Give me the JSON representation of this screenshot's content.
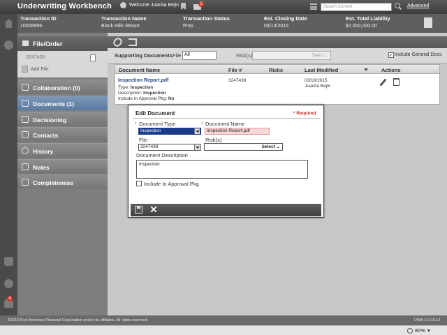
{
  "app": {
    "title": "Underwriting Workbench",
    "welcome": "Welcome Juanita Bejin",
    "mail_count": "2",
    "search_placeholder": "Search Content",
    "advanced_label": "Advanced"
  },
  "transaction": {
    "columns": [
      {
        "label": "Transaction ID",
        "value": "10008999"
      },
      {
        "label": "Transaction Name",
        "value": "Black Hills Resort"
      },
      {
        "label": "Transaction Status",
        "value": "Prep"
      },
      {
        "label": "Est. Closing Date",
        "value": "03/13/2015"
      },
      {
        "label": "Est. Total Liability",
        "value": "$7,000,000.00"
      }
    ]
  },
  "rail": {
    "notification_count": "4"
  },
  "sidebar": {
    "header": "File/Order",
    "file_number": "3247438",
    "add_file": "Add File",
    "items": [
      {
        "label": "Collaboration (0)"
      },
      {
        "label": "Documents (1)"
      },
      {
        "label": "Decisioning"
      },
      {
        "label": "Contacts"
      },
      {
        "label": "History"
      },
      {
        "label": "Notes"
      },
      {
        "label": "Completeness"
      }
    ]
  },
  "documents": {
    "title": "Supporting Documents",
    "file_label": "File",
    "file_value": "All",
    "risks_label": "Risk(s)",
    "risks_placeholder": "Select ⌄",
    "include_general_label": "Include General Docs",
    "include_general_checked": "✓",
    "columns": [
      "Document Name",
      "File #",
      "Risks",
      "Last Modified",
      "Actions"
    ],
    "row": {
      "name": "Inspection Report.pdf",
      "type_label": "Type:",
      "type_value": "Inspection",
      "desc_label": "Description:",
      "desc_value": "Inspection",
      "approval_label": "Include In Approval Pkg:",
      "approval_value": "No",
      "file_no": "3247438",
      "modified_date": "03/18/2015",
      "modified_by": "Juanita Bejin"
    }
  },
  "modal": {
    "title": "Edit Document",
    "required": "* Required",
    "doc_type_label": "Document Type",
    "doc_type_value": "Inspection",
    "doc_name_label": "Document Name",
    "doc_name_value": "Inspection Report.pdf",
    "file_label": "File",
    "file_value": "3247438",
    "risks_label": "Risk(s)",
    "risks_value": "Select ⌄",
    "desc_label": "Document Description",
    "desc_value": "Inspection",
    "include_label": "Include In Approval Pkg",
    "star": "*"
  },
  "footer": {
    "copyright": "©2015 First American Financial Corporation and/or its affiliates. All rights reserved.",
    "version": "UWB 1.0.15.10",
    "zoom": "80%"
  }
}
